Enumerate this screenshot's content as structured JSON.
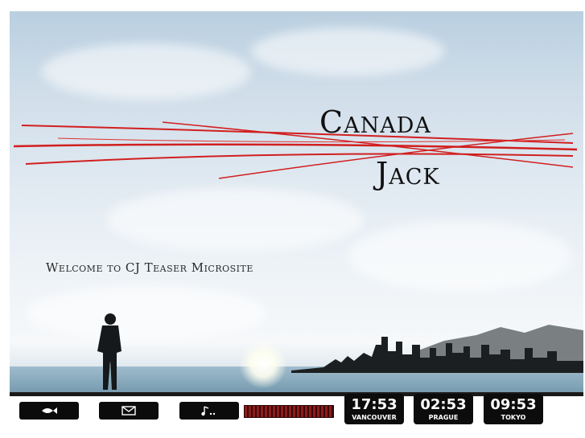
{
  "brand": {
    "line1": "Canada",
    "line2": "Jack",
    "accent_color": "#d11f1f"
  },
  "welcome": {
    "text": "Welcome to CJ Teaser Microsite"
  },
  "toolbar": {
    "buttons": [
      {
        "icon": "fish-icon"
      },
      {
        "icon": "envelope-icon"
      },
      {
        "icon": "music-note-icon"
      }
    ],
    "volume_icon": "level-meter"
  },
  "clocks": [
    {
      "time": "17:53",
      "city": "VANCOUVER"
    },
    {
      "time": "02:53",
      "city": "PRAGUE"
    },
    {
      "time": "09:53",
      "city": "TOKYO"
    }
  ]
}
